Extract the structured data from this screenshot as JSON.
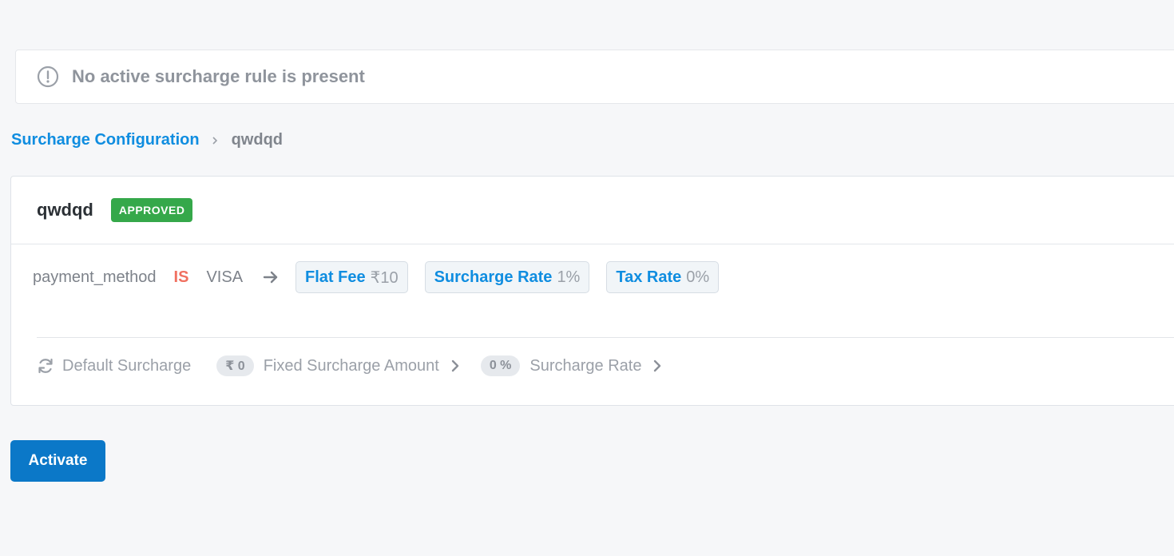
{
  "alert": {
    "text": "No active surcharge rule is present",
    "icon": "info-circle-icon"
  },
  "breadcrumb": {
    "parent": "Surcharge Configuration",
    "current": "qwdqd"
  },
  "card": {
    "title": "qwdqd",
    "status": "APPROVED",
    "status_color": "#35a84a",
    "rule": {
      "field": "payment_method",
      "operator": "IS",
      "value": "VISA",
      "chips": [
        {
          "label": "Flat Fee",
          "value": "₹10"
        },
        {
          "label": "Surcharge Rate",
          "value": "1%"
        },
        {
          "label": "Tax Rate",
          "value": "0%"
        }
      ]
    },
    "default": {
      "label": "Default Surcharge",
      "fixed_amount": "₹ 0",
      "fixed_label": "Fixed Surcharge Amount",
      "rate": "0 %",
      "rate_label": "Surcharge Rate"
    }
  },
  "actions": {
    "activate_label": "Activate"
  },
  "colors": {
    "accent": "#0f8de0",
    "button": "#0b78c8",
    "operator": "#f07060"
  }
}
